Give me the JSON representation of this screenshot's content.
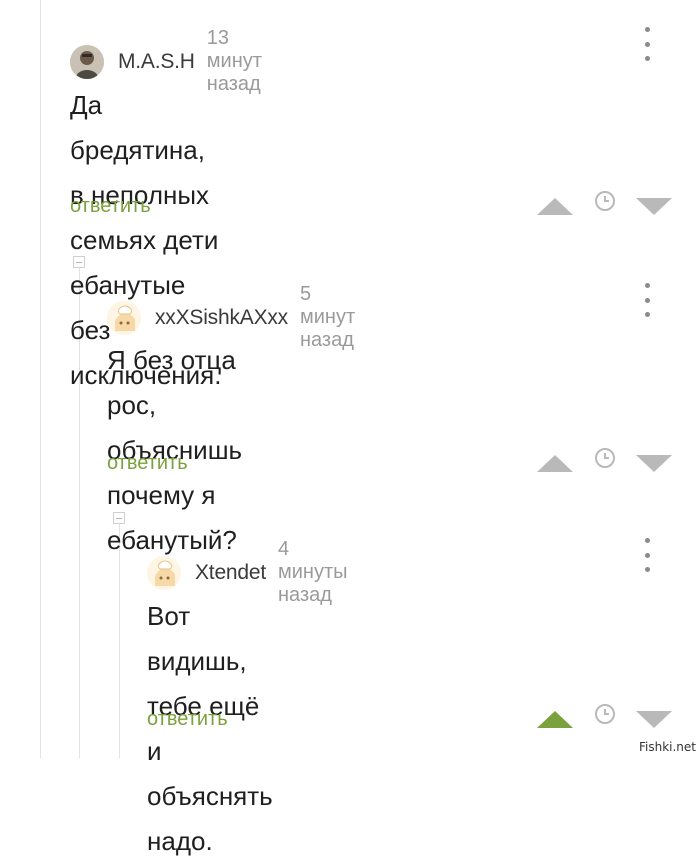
{
  "comments": [
    {
      "username": "M.A.S.H",
      "time": "13 минут назад",
      "text_line1": "Да бредятина, в неполных семьях дети",
      "text_line2": "ебанутые без исключения.",
      "reply_label": "ответить",
      "avatar": "user-photo",
      "upvoted": false
    },
    {
      "username": "xxXSishkAXxx",
      "time": "5 минут назад",
      "text_line1": "Я без отца рос, объяснишь почему я",
      "text_line2": "ебанутый?",
      "reply_label": "ответить",
      "avatar": "default-avatar",
      "upvoted": false
    },
    {
      "username": "Xtendet",
      "time": "4 минуты назад",
      "text_line1": "Вот видишь, тебе ещё и объяснять",
      "text_line2": "надо.",
      "reply_label": "ответить",
      "avatar": "default-avatar",
      "upvoted": true
    }
  ],
  "colors": {
    "accent_green": "#7ba13d",
    "vote_gray": "#b9b9b9",
    "dots_gray": "#8a8a8a"
  },
  "watermark": "Fishki.net"
}
